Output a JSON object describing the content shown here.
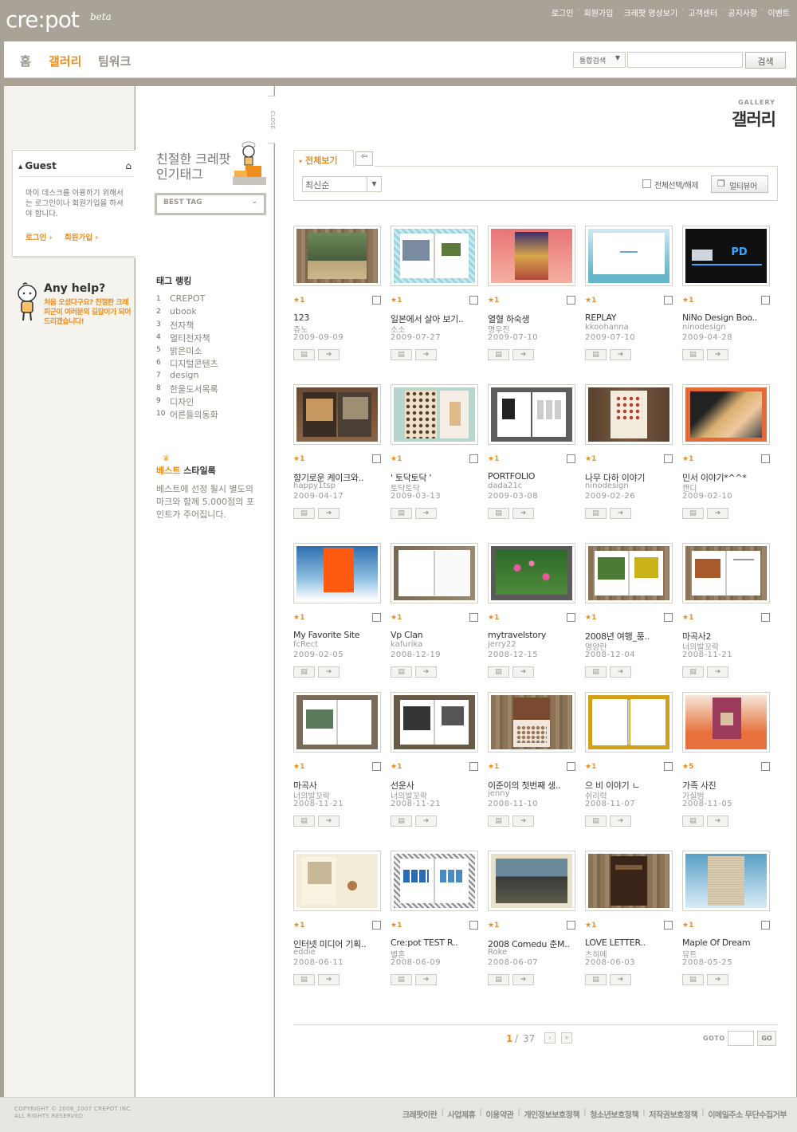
{
  "header": {
    "logo": "cre:pot",
    "beta": "beta",
    "links": [
      "로그인",
      "회원가입",
      "크레팟 영상보기",
      "고객센터",
      "공지사항",
      "이벤트"
    ]
  },
  "nav": {
    "tabs": [
      "홈",
      "갤러리",
      "팀워크"
    ],
    "active_tab": "갤러리",
    "search_type": "통합검색",
    "search_value": "",
    "search_button": "검색"
  },
  "guest": {
    "title": "Guest",
    "message": "마이 데스크를 이용하기 위해서는 로그인이나 회원가입을 하셔야 합니다.",
    "login": "로그인",
    "join": "회원가입"
  },
  "help": {
    "title": "Any help?",
    "text": "처음 오셨다구요? 친절한 크레피군이 여러분의 길잡이가 되어드리겠습니다!"
  },
  "tags": {
    "heading_line1": "친절한 크레팟",
    "heading_line2": "인기태그",
    "best_tag": "BEST TAG",
    "close_label": "CLOSE",
    "ranking_title": "태그 랭킹",
    "ranking": [
      {
        "rank": "1",
        "tag": "CREPOT"
      },
      {
        "rank": "2",
        "tag": "ubook"
      },
      {
        "rank": "3",
        "tag": "전자책"
      },
      {
        "rank": "4",
        "tag": "멀티전자책"
      },
      {
        "rank": "5",
        "tag": "밝은미소"
      },
      {
        "rank": "6",
        "tag": "디지털콘텐츠"
      },
      {
        "rank": "7",
        "tag": "design"
      },
      {
        "rank": "8",
        "tag": "한울도서목록"
      },
      {
        "rank": "9",
        "tag": "디자인"
      },
      {
        "rank": "10",
        "tag": "어른들의동화"
      }
    ],
    "best_title_orange": "베스트",
    "best_title_rest": " 스타일록",
    "best_text": "베스트에 선정 될시 별도의 마크와 함께 5,000점의 포인트가 주어집니다."
  },
  "gallery": {
    "sub_title": "GALLERY",
    "title": "갤러리",
    "tab_all": "전체보기",
    "sort": "최신순",
    "select_all": "전체선택/해제",
    "multiviewer": "멀티뷰어",
    "items": [
      {
        "rating": "★1",
        "title": "123",
        "author": "쥬노",
        "date": "2009-09-09",
        "style": "photo-stairs"
      },
      {
        "rating": "★1",
        "title": "일본에서 살아 보기..",
        "author": "소소",
        "date": "2009-07-27",
        "style": "blue-book"
      },
      {
        "rating": "★1",
        "title": "열혈 하숙생",
        "author": "명우진",
        "date": "2009-07-10",
        "style": "comic-cover"
      },
      {
        "rating": "★1",
        "title": "REPLAY",
        "author": "kkoohanna",
        "date": "2009-07-10",
        "style": "sky-cover"
      },
      {
        "rating": "★1",
        "title": "NiNo Design Boo..",
        "author": "ninodesign",
        "date": "2009-04-28",
        "style": "dark-pd"
      },
      {
        "rating": "★1",
        "title": "향기로운 케이크와..",
        "author": "happy1tsp",
        "date": "2009-04-17",
        "style": "cafe-book"
      },
      {
        "rating": "★1",
        "title": "' 토닥토닥 '",
        "author": "토닥토닥",
        "date": "2009-03-13",
        "style": "dots-book"
      },
      {
        "rating": "★1",
        "title": "PORTFOLIO",
        "author": "dada21c",
        "date": "2009-03-08",
        "style": "portfolio"
      },
      {
        "rating": "★1",
        "title": "나무 다하 이야기",
        "author": "ninodesign",
        "date": "2009-02-26",
        "style": "wood-cover"
      },
      {
        "rating": "★1",
        "title": "민서 이야기*^^*",
        "author": "캔디",
        "date": "2009-02-10",
        "style": "kid-photo"
      },
      {
        "rating": "★1",
        "title": "My Favorite Site",
        "author": "fcRect",
        "date": "2009-02-05",
        "style": "orange-sky"
      },
      {
        "rating": "★1",
        "title": "Vp Clan",
        "author": "kafurika",
        "date": "2008-12-19",
        "style": "blank-book"
      },
      {
        "rating": "★1",
        "title": "mytravelstory",
        "author": "jerry22",
        "date": "2008-12-15",
        "style": "lotus"
      },
      {
        "rating": "★1",
        "title": "2008년 여행_풍..",
        "author": "영양란",
        "date": "2008-12-04",
        "style": "nature-book"
      },
      {
        "rating": "★1",
        "title": "마곡사2",
        "author": "너의발꼬락",
        "date": "2008-11-21",
        "style": "autumn-book"
      },
      {
        "rating": "★1",
        "title": "마곡사",
        "author": "너의발꼬락",
        "date": "2008-11-21",
        "style": "temple-book"
      },
      {
        "rating": "★1",
        "title": "선운사",
        "author": "너의발꼬락",
        "date": "2008-11-21",
        "style": "bw-book"
      },
      {
        "rating": "★1",
        "title": "이준이의 첫번째 생..",
        "author": "jenny",
        "date": "2008-11-10",
        "style": "brown-cover"
      },
      {
        "rating": "★1",
        "title": "으 비 이야기 ㄴ",
        "author": "쉬리력",
        "date": "2008-11-07",
        "style": "gold-frame"
      },
      {
        "rating": "★5",
        "title": "가족 사진",
        "author": "가실범",
        "date": "2008-11-05",
        "style": "family-cover"
      },
      {
        "rating": "★1",
        "title": "인터넷 미디어 기획..",
        "author": "eddie",
        "date": "2008-06-11",
        "style": "media-book"
      },
      {
        "rating": "★1",
        "title": "Cre:pot TEST R..",
        "author": "별혼",
        "date": "2008-06-09",
        "style": "test-book"
      },
      {
        "rating": "★1",
        "title": "2008 Comedu 춘M..",
        "author": "Roke",
        "date": "2008-06-07",
        "style": "group-photo"
      },
      {
        "rating": "★1",
        "title": "LOVE LETTER..",
        "author": "츠히메",
        "date": "2008-06-03",
        "style": "leather-cover"
      },
      {
        "rating": "★1",
        "title": "Maple Of Dream",
        "author": "뮤트",
        "date": "2008-05-25",
        "style": "linen-cover"
      }
    ],
    "page_current": "1",
    "page_sep": "/",
    "page_total": "37",
    "goto_label": "GOTO",
    "go_button": "GO"
  },
  "footer": {
    "copyright_line1": "COPYRIGHT © 2006_2007 CREPOT INC.",
    "copyright_line2": "ALL RIGHTS RESERVED.",
    "links": [
      "크레팟이란",
      "사업제휴",
      "이용약관",
      "개인정보보호정책",
      "청소년보호정책",
      "저작권보호정책",
      "이메일주소 무단수집거부"
    ]
  },
  "colors": {
    "accent": "#f08c1a",
    "frame": "#a8a396"
  }
}
